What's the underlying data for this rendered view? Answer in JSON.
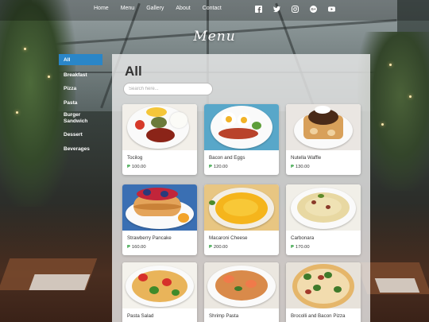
{
  "nav": {
    "links": [
      "Home",
      "Menu",
      "Gallery",
      "About",
      "Contact"
    ],
    "social_icons": [
      "facebook-icon",
      "twitter-icon",
      "instagram-icon",
      "google-plus-icon",
      "youtube-icon"
    ]
  },
  "header": {
    "title": "Menu"
  },
  "sidebar": {
    "items": [
      {
        "label": "All",
        "active": true
      },
      {
        "label": "Breakfast"
      },
      {
        "label": "Pizza"
      },
      {
        "label": "Pasta"
      },
      {
        "label": "Burger Sandwich"
      },
      {
        "label": "Dessert"
      },
      {
        "label": "Beverages"
      }
    ]
  },
  "main": {
    "title": "All",
    "search": {
      "placeholder": "Search here...",
      "value": ""
    },
    "currency_symbol": "₱",
    "items": [
      {
        "name": "Tocilog",
        "price": "100.00"
      },
      {
        "name": "Bacon and Eggs",
        "price": "120.00"
      },
      {
        "name": "Nutella Waffle",
        "price": "130.00"
      },
      {
        "name": "Strawberry Pancake",
        "price": "160.00"
      },
      {
        "name": "Macaroni Cheese",
        "price": "200.00"
      },
      {
        "name": "Carbonara",
        "price": "170.00"
      },
      {
        "name": "Pasta Salad",
        "price": ""
      },
      {
        "name": "Shrimp Pasta",
        "price": ""
      },
      {
        "name": "Brocolli and Bacon Pizza",
        "price": ""
      }
    ]
  },
  "colors": {
    "accent": "#2a86c8",
    "price_symbol": "#2a9d3a"
  }
}
